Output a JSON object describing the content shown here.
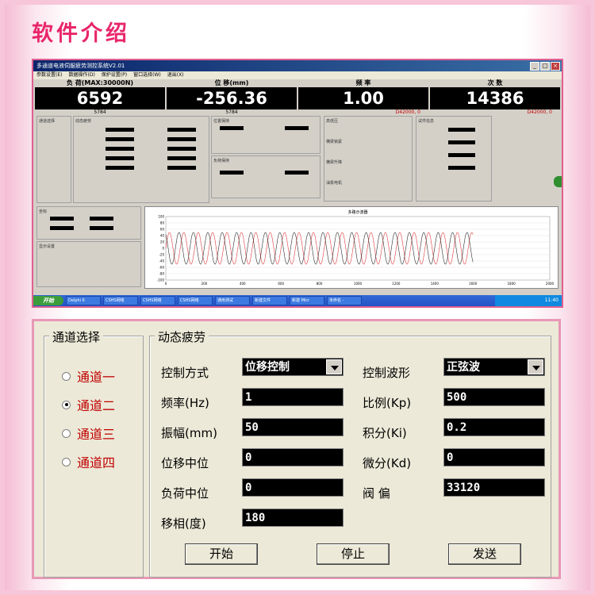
{
  "page": {
    "title": "软件介绍"
  },
  "window": {
    "title": "多通道电液伺服疲劳测控系统V2.01",
    "menu": [
      "参数设置(E)",
      "数据操作(D)",
      "保护设置(P)",
      "窗口选择(W)",
      "退出(X)"
    ],
    "readouts": [
      {
        "label": "负 荷(MAX:30000N)",
        "value": "6592",
        "sub": "5784",
        "sub_right": ""
      },
      {
        "label": "位 移(mm)",
        "value": "-256.36",
        "sub": "5784",
        "sub_right": ""
      },
      {
        "label": "频 率",
        "value": "1.00",
        "sub": "",
        "sub_right": "D42000, 0"
      },
      {
        "label": "次 数",
        "value": "14386",
        "sub": "",
        "sub_right": "D42000, 0"
      }
    ],
    "mini_sections": {
      "channel": "通道选择",
      "fatigue": "动态疲劳",
      "pos_hold": "位置保持",
      "load_hold": "负荷保持",
      "hp": "高低压",
      "lock": "横梁锁紧",
      "lift": "横梁升降",
      "motor": "油泵电机",
      "info": "试件信息",
      "axes": "坐标",
      "display": "显示设置",
      "osc": "多路示波器"
    },
    "taskbar": {
      "start": "开始",
      "items": [
        "Delphi 6",
        "CSHS网络",
        "CSHS网络",
        "CSHS网络",
        "通用测试",
        "新建文件",
        "新建 Micr",
        "未命名 -"
      ],
      "clock": "11:40"
    }
  },
  "chart_data": {
    "type": "line",
    "title": "多路示波器",
    "xlim": [
      0,
      2000
    ],
    "ylim": [
      -100,
      100
    ],
    "x_ticks": [
      "0",
      "200",
      "400",
      "600",
      "800",
      "1000",
      "1200",
      "1400",
      "1600",
      "1800",
      "2000"
    ],
    "y_ticks": [
      "100",
      "80",
      "60",
      "40",
      "20",
      "0",
      "-20",
      "-40",
      "-60",
      "-80",
      "-100"
    ],
    "series": [
      {
        "color": "#e04040",
        "amplitude": 50,
        "period": 75,
        "phase": 0,
        "x_end": 1600
      },
      {
        "color": "#303030",
        "amplitude": 50,
        "period": 75,
        "phase": 25,
        "x_end": 1600
      }
    ]
  },
  "channels": {
    "title": "通道选择",
    "items": [
      {
        "label": "通道一",
        "selected": false
      },
      {
        "label": "通道二",
        "selected": true
      },
      {
        "label": "通道三",
        "selected": false
      },
      {
        "label": "通道四",
        "selected": false
      }
    ]
  },
  "fatigue": {
    "title": "动态疲劳",
    "control_mode": {
      "label": "控制方式",
      "value": "位移控制"
    },
    "waveform": {
      "label": "控制波形",
      "value": "正弦波"
    },
    "frequency": {
      "label": "频率(Hz)",
      "value": "1"
    },
    "kp": {
      "label": "比例(Kp)",
      "value": "500"
    },
    "amplitude": {
      "label": "振幅(mm)",
      "value": "50"
    },
    "ki": {
      "label": "积分(Ki)",
      "value": "0.2"
    },
    "disp_center": {
      "label": "位移中位",
      "value": "0"
    },
    "kd": {
      "label": "微分(Kd)",
      "value": "0"
    },
    "load_center": {
      "label": "负荷中位",
      "value": "0"
    },
    "valve_bias": {
      "label": "阀 偏",
      "value": "33120"
    },
    "phase": {
      "label": "移相(度)",
      "value": "180"
    },
    "buttons": {
      "start": "开始",
      "stop": "停止",
      "send": "发送"
    }
  }
}
